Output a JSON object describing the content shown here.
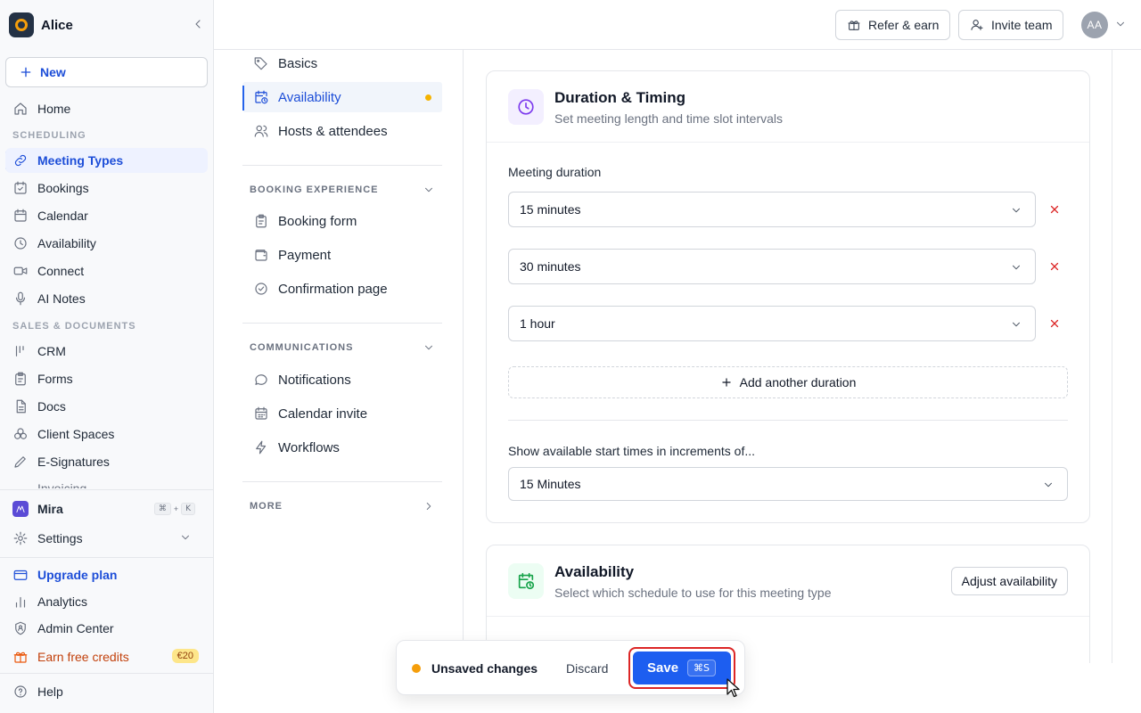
{
  "workspace": {
    "name": "Alice"
  },
  "sidebar": {
    "new_label": "New",
    "home_label": "Home",
    "scheduling_label": "SCHEDULING",
    "scheduling_items": [
      {
        "label": "Meeting Types",
        "icon": "link-icon",
        "active": true
      },
      {
        "label": "Bookings",
        "icon": "calendar-check-icon"
      },
      {
        "label": "Calendar",
        "icon": "calendar-icon"
      },
      {
        "label": "Availability",
        "icon": "clock-icon"
      },
      {
        "label": "Connect",
        "icon": "video-icon"
      },
      {
        "label": "AI Notes",
        "icon": "microphone-icon"
      }
    ],
    "sales_label": "SALES & DOCUMENTS",
    "sales_items": [
      {
        "label": "CRM",
        "icon": "crm-icon"
      },
      {
        "label": "Forms",
        "icon": "clipboard-icon"
      },
      {
        "label": "Docs",
        "icon": "document-icon"
      },
      {
        "label": "Client Spaces",
        "icon": "spaces-icon"
      },
      {
        "label": "E-Signatures",
        "icon": "pen-icon"
      },
      {
        "label": "Invoicing",
        "icon": "invoice-icon"
      }
    ],
    "mira_label": "Mira",
    "mira_kbd": [
      "⌘",
      "+",
      "K"
    ],
    "settings_label": "Settings",
    "upgrade_label": "Upgrade plan",
    "analytics_label": "Analytics",
    "admin_label": "Admin Center",
    "earn_label": "Earn free credits",
    "earn_badge": "€20",
    "help_label": "Help"
  },
  "topbar": {
    "refer_label": "Refer & earn",
    "invite_label": "Invite team",
    "avatar_initials": "AA"
  },
  "subnav": {
    "items_top": [
      {
        "label": "Basics",
        "icon": "tag-icon"
      },
      {
        "label": "Availability",
        "icon": "calendar-clock-icon",
        "active": true,
        "unsaved_dot": true
      },
      {
        "label": "Hosts & attendees",
        "icon": "users-icon"
      }
    ],
    "booking_section": "BOOKING EXPERIENCE",
    "booking_items": [
      {
        "label": "Booking form",
        "icon": "clipboard-icon"
      },
      {
        "label": "Payment",
        "icon": "wallet-icon"
      },
      {
        "label": "Confirmation page",
        "icon": "check-circle-icon"
      }
    ],
    "comm_section": "COMMUNICATIONS",
    "comm_items": [
      {
        "label": "Notifications",
        "icon": "message-icon"
      },
      {
        "label": "Calendar invite",
        "icon": "calendar-icon"
      },
      {
        "label": "Workflows",
        "icon": "bolt-icon"
      }
    ],
    "more_section": "MORE"
  },
  "duration_card": {
    "title": "Duration & Timing",
    "subtitle": "Set meeting length and time slot intervals",
    "duration_label": "Meeting duration",
    "durations": [
      "15 minutes",
      "30 minutes",
      "1 hour"
    ],
    "add_label": "Add another duration",
    "increment_label": "Show available start times in increments of...",
    "increment_value": "15 Minutes",
    "icon_color": "#7c3aed"
  },
  "availability_card": {
    "title": "Availability",
    "subtitle": "Select which schedule to use for this meeting type",
    "button_label": "Adjust availability",
    "icon_color": "#16a34a"
  },
  "unsaved_bar": {
    "message": "Unsaved changes",
    "discard_label": "Discard",
    "save_label": "Save",
    "save_shortcut": "⌘S"
  },
  "colors": {
    "accent": "#1d5ef0",
    "unsaved_dot": "#f59e0b",
    "danger": "#dc2626"
  }
}
